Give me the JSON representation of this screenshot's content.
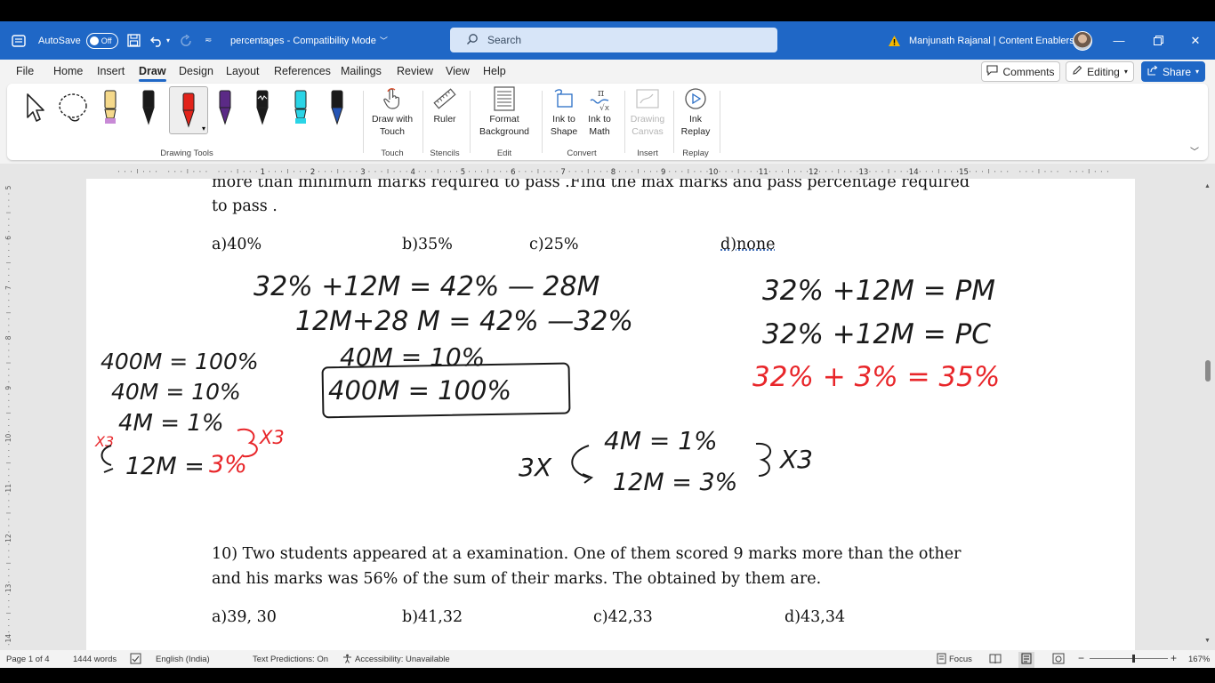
{
  "titlebar": {
    "autosave_label": "AutoSave",
    "autosave_state": "Off",
    "doc_title": "percentages  -  Compatibility Mode",
    "search_placeholder": "Search",
    "user_name": "Manjunath Rajanal | Content Enablers"
  },
  "menubar": {
    "items": [
      "File",
      "Home",
      "Insert",
      "Draw",
      "Design",
      "Layout",
      "References",
      "Mailings",
      "Review",
      "View",
      "Help"
    ],
    "active": "Draw",
    "comments_label": "Comments",
    "editing_label": "Editing",
    "share_label": "Share"
  },
  "ribbon": {
    "drawing_tools_label": "Drawing Tools",
    "touch": {
      "button_line1": "Draw with",
      "button_line2": "Touch",
      "group": "Touch"
    },
    "stencils": {
      "button": "Ruler",
      "group": "Stencils"
    },
    "edit": {
      "button_line1": "Format",
      "button_line2": "Background",
      "group": "Edit"
    },
    "convert": {
      "shape_line1": "Ink to",
      "shape_line2": "Shape",
      "math_line1": "Ink to",
      "math_line2": "Math",
      "group": "Convert"
    },
    "insert": {
      "button_line1": "Drawing",
      "button_line2": "Canvas",
      "group": "Insert"
    },
    "replay": {
      "button_line1": "Ink",
      "button_line2": "Replay",
      "group": "Replay"
    },
    "pen_colors": [
      "#f5d98b",
      "#1a1a1a",
      "#e2231a",
      "#5b2a86",
      "#1a1a1a",
      "#2ad4e6",
      "#2454b5"
    ]
  },
  "ruler": {
    "h_numbers": [
      "1",
      "2",
      "3",
      "4",
      "5",
      "6",
      "7",
      "8",
      "9",
      "10",
      "11",
      "12",
      "13",
      "14",
      "15"
    ],
    "v_numbers": [
      "5",
      "6",
      "7",
      "8",
      "9",
      "10",
      "11",
      "12",
      "13",
      "14"
    ]
  },
  "document": {
    "q9_line1": "more than minimum marks required to pass .Find the max marks and pass percentage required",
    "q9_line2": "to pass .",
    "q9_options": [
      "a)40%",
      "b)35%",
      "c)25%",
      "d)none"
    ],
    "q10_line1": "10) Two students appeared at a examination. One of them scored 9 marks more than the other",
    "q10_line2": "and his marks was 56% of the sum of their marks. The obtained by them are.",
    "q10_options": [
      "a)39, 30",
      "b)41,32",
      "c)42,33",
      "d)43,34"
    ]
  },
  "handwriting": {
    "black": [
      "32% +12M = 42%  — 28M",
      "12M+28 M = 42% —32%",
      "40M = 10%",
      "400M = 100%",
      "400M = 100%",
      "40M = 10%",
      "4M = 1%",
      "12M =",
      "4M = 1%",
      "3X",
      "12M = 3%",
      "X3",
      "32% +12M = PM",
      "32% +12M = PC"
    ],
    "red": [
      "3%",
      "X3",
      "X3",
      "32% + 3% = 35%"
    ]
  },
  "statusbar": {
    "page": "Page 1 of 4",
    "words": "1444 words",
    "language": "English (India)",
    "predictions": "Text Predictions: On",
    "accessibility": "Accessibility: Unavailable",
    "focus": "Focus",
    "zoom": "167%"
  }
}
